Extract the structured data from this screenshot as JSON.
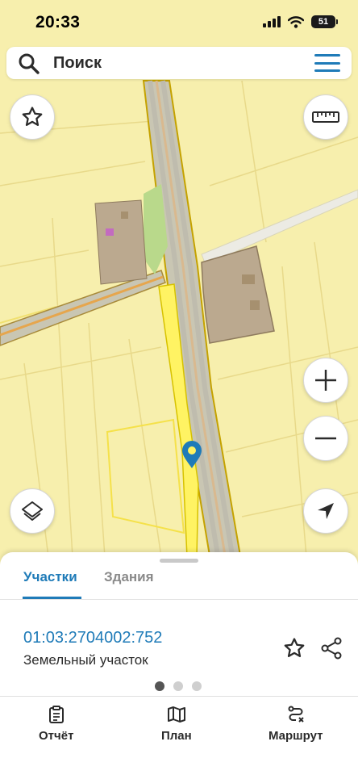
{
  "status_bar": {
    "time": "20:33",
    "battery": "51"
  },
  "search": {
    "label": "Поиск"
  },
  "map": {
    "accent": "#1f7bb8",
    "parcel_fill": "#f7efad",
    "selected_parcel": "#fff363",
    "building": "#bba98f"
  },
  "sheet": {
    "tabs": [
      {
        "label": "Участки",
        "active": true
      },
      {
        "label": "Здания",
        "active": false
      }
    ],
    "parcel": {
      "number": "01:03:2704002:752",
      "type": "Земельный участок"
    },
    "pager": {
      "pages": 3,
      "current": 1
    }
  },
  "nav": {
    "items": [
      {
        "label": "Отчёт",
        "icon": "report-icon"
      },
      {
        "label": "План",
        "icon": "map-icon"
      },
      {
        "label": "Маршрут",
        "icon": "route-icon"
      }
    ]
  }
}
